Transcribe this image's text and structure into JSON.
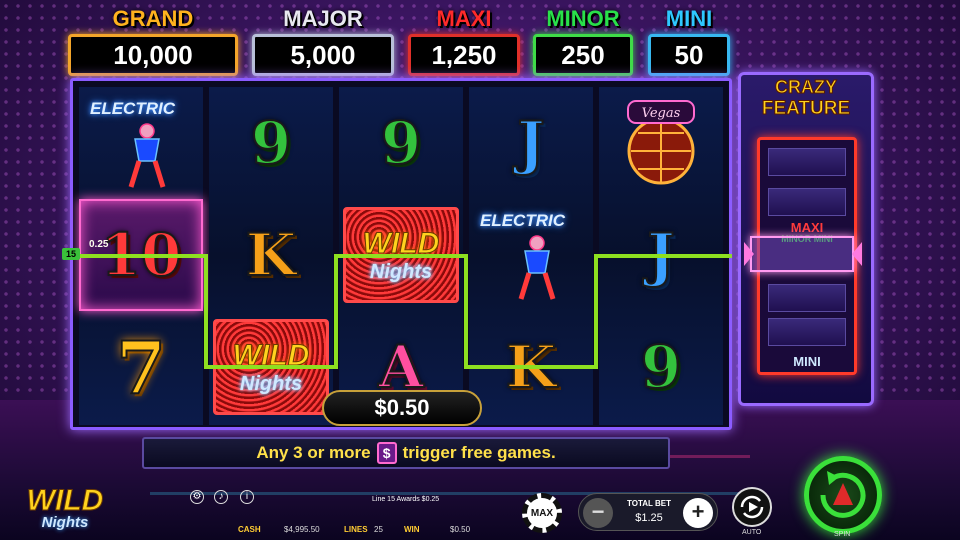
{
  "jackpots": {
    "grand": {
      "label": "GRAND",
      "value": "10,000"
    },
    "major": {
      "label": "MAJOR",
      "value": "5,000"
    },
    "maxi": {
      "label": "MAXI",
      "value": "1,250"
    },
    "minor": {
      "label": "MINOR",
      "value": "250"
    },
    "mini": {
      "label": "MINI",
      "value": "50"
    }
  },
  "reels": {
    "symbols": {
      "electric_label": "ELECTRIC",
      "nine": "9",
      "king": "K",
      "jack": "J",
      "ace": "A",
      "ten": "10",
      "seven": "7",
      "wild_line1": "WILD",
      "wild_line2": "Nights",
      "vegas_label": "Vegas"
    },
    "mini_value": "0.25",
    "line_tag": "15"
  },
  "win_amount": "$0.50",
  "feature": {
    "title_line1": "CRAZY",
    "title_line2": "FEATURE",
    "labels": {
      "maxi": "MAXI",
      "minor_mini": "MINOR MINI",
      "mini": "MINI"
    }
  },
  "message": {
    "before": "Any 3 or more",
    "icon": "$",
    "after": "trigger free games."
  },
  "logo": {
    "line1": "WILD",
    "line2": "Nights"
  },
  "info_line": "Line 15 Awards $0.25",
  "status": {
    "cash_label": "CASH",
    "cash_value": "$4,995.50",
    "lines_label": "LINES",
    "lines_value": "25",
    "win_label": "WIN",
    "win_value": "$0.50"
  },
  "controls": {
    "max_label": "MAX",
    "total_bet_label": "TOTAL BET",
    "total_bet_value": "$1.25",
    "minus": "−",
    "plus": "+",
    "auto_label": "AUTO",
    "spin_label": "SPIN"
  },
  "icons": [
    "settings-icon",
    "sound-icon",
    "info-icon"
  ],
  "colors": {
    "payline": "#8ee020",
    "grand": "#ffb21e",
    "maxi": "#ff2a2a",
    "minor": "#29e04a",
    "mini": "#2ec8ff",
    "spin": "#3ae03a"
  }
}
